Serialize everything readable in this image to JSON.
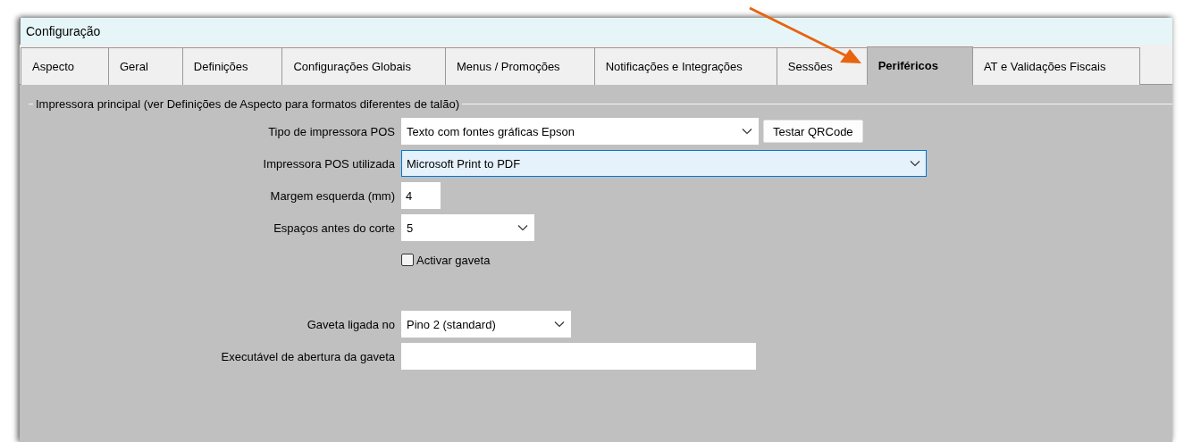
{
  "window": {
    "title": "Configuração"
  },
  "tabs": [
    {
      "label": "Aspecto",
      "selected": false
    },
    {
      "label": "Geral",
      "selected": false
    },
    {
      "label": "Definições",
      "selected": false
    },
    {
      "label": "Configurações Globais",
      "selected": false
    },
    {
      "label": "Menus / Promoções",
      "selected": false
    },
    {
      "label": "Notificações e Integrações",
      "selected": false
    },
    {
      "label": "Sessões",
      "selected": false
    },
    {
      "label": "Periféricos",
      "selected": true
    },
    {
      "label": "AT e Validações Fiscais",
      "selected": false
    }
  ],
  "group": {
    "title": "Impressora principal (ver Definições de Aspecto para formatos diferentes de talão)",
    "fields": [
      {
        "kind": "dropdown",
        "label": "Tipo de impressora POS",
        "value": "Texto com fontes gráficas Epson",
        "focused": false,
        "button": "Testar QRCode"
      },
      {
        "kind": "dropdown",
        "label": "Impressora POS utilizada",
        "value": "Microsoft Print to PDF",
        "focused": true
      },
      {
        "kind": "text",
        "label": "Margem esquerda (mm)",
        "value": "4"
      },
      {
        "kind": "dropdown",
        "label": "Espaços antes do corte",
        "value": "5",
        "focused": false
      },
      {
        "kind": "checkbox",
        "label": "Activar gaveta",
        "checked": false
      },
      {
        "kind": "spacer"
      },
      {
        "kind": "dropdown",
        "label": "Gaveta ligada no",
        "value": "Pino 2 (standard)",
        "focused": false
      },
      {
        "kind": "text",
        "label": "Executável de abertura da gaveta"
      }
    ]
  }
}
